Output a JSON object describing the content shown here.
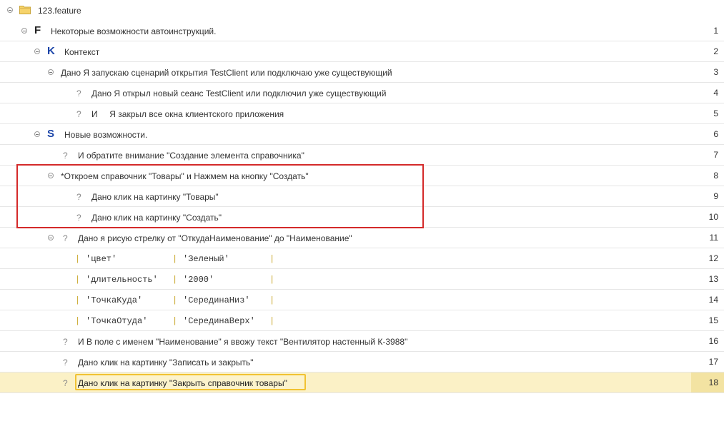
{
  "root": {
    "label": "123.feature"
  },
  "rows": [
    {
      "num": "1",
      "letter": "F",
      "text": "Некоторые возможности автоинструкций."
    },
    {
      "num": "2",
      "letter": "K",
      "text": "Контекст"
    },
    {
      "num": "3",
      "text": "Дано Я запускаю сценарий открытия TestClient или подключаю уже существующий"
    },
    {
      "num": "4",
      "q": "?",
      "text": "Дано Я открыл новый сеанс TestClient или подключил уже существующий"
    },
    {
      "num": "5",
      "q": "?",
      "text": "И     Я закрыл все окна клиентского приложения"
    },
    {
      "num": "6",
      "letter": "S",
      "text": "Новые возможности."
    },
    {
      "num": "7",
      "q": "?",
      "text": "И обратите внимание \"Создание элемента справочника\""
    },
    {
      "num": "8",
      "text": "*Откроем справочник \"Товары\" и Нажмем на кнопку \"Создать\""
    },
    {
      "num": "9",
      "q": "?",
      "text": "Дано клик на картинку \"Товары\""
    },
    {
      "num": "10",
      "q": "?",
      "text": "Дано клик на картинку \"Создать\""
    },
    {
      "num": "11",
      "q": "?",
      "text": "Дано я рисую стрелку от \"ОткудаНаименование\" до \"Наименование\""
    },
    {
      "num": "12",
      "pipe": "|",
      "col1": "'цвет'",
      "col2": "'Зеленый'"
    },
    {
      "num": "13",
      "pipe": "|",
      "col1": "'длительность'",
      "col2": "'2000'"
    },
    {
      "num": "14",
      "pipe": "|",
      "col1": "'ТочкаКуда'",
      "col2": "'СерединаНиз'"
    },
    {
      "num": "15",
      "pipe": "|",
      "col1": "'ТочкаОтуда'",
      "col2": "'СерединаВерх'"
    },
    {
      "num": "16",
      "q": "?",
      "text": "И В поле с именем \"Наименование\" я ввожу текст \"Вентилятор настенный К-3988\""
    },
    {
      "num": "17",
      "q": "?",
      "text": "Дано клик на картинку \"Записать и закрыть\""
    },
    {
      "num": "18",
      "q": "?",
      "text": "Дано клик на картинку \"Закрыть справочник товары\""
    }
  ],
  "colors": {
    "highlight_box": "#d42a2a",
    "selected_row_bg": "#fbf1c6",
    "selected_frame": "#f1c232",
    "keyword_blue": "#1a44a8"
  }
}
